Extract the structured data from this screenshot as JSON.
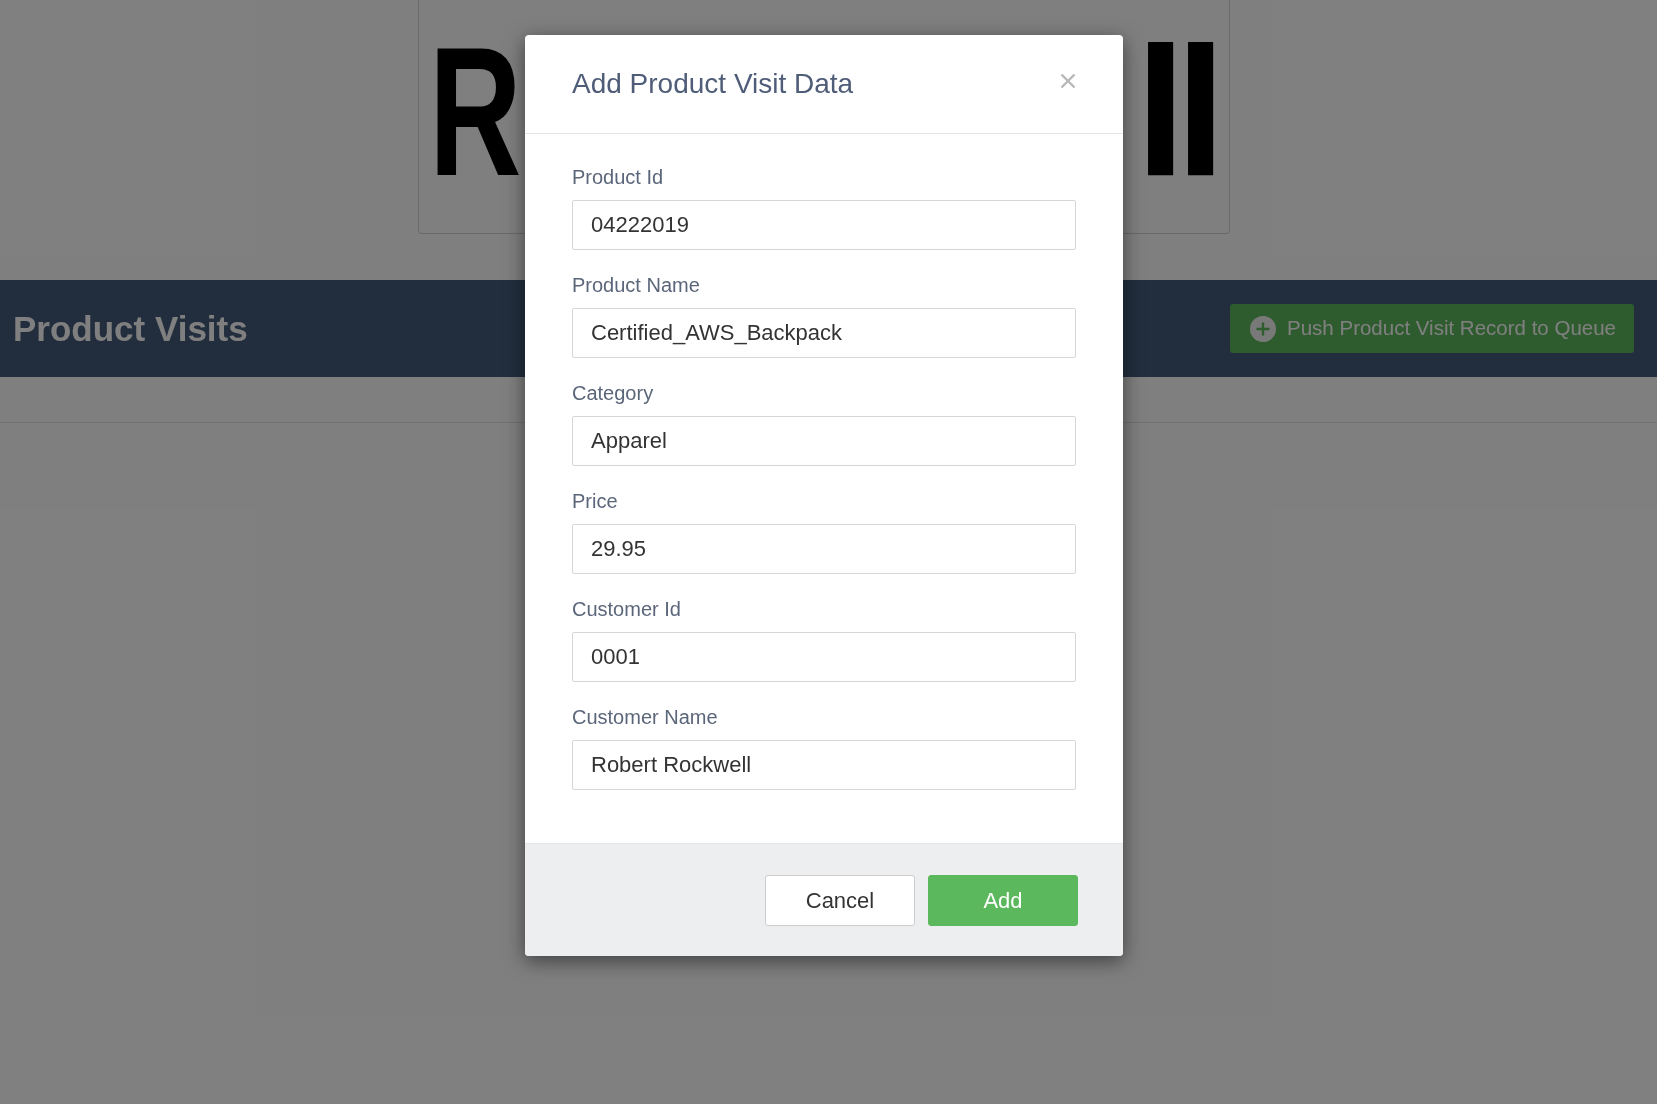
{
  "background": {
    "logo": {
      "left_part": "R",
      "right_part": "ll"
    },
    "header": {
      "title": "Product Visits",
      "push_button": {
        "label": "Push Product Visit Record to Queue"
      }
    }
  },
  "modal": {
    "title": "Add Product Visit Data",
    "fields": [
      {
        "label": "Product Id",
        "value": "04222019"
      },
      {
        "label": "Product Name",
        "value": "Certified_AWS_Backpack"
      },
      {
        "label": "Category",
        "value": "Apparel"
      },
      {
        "label": "Price",
        "value": "29.95"
      },
      {
        "label": "Customer Id",
        "value": "0001"
      },
      {
        "label": "Customer Name",
        "value": "Robert Rockwell"
      }
    ],
    "buttons": [
      {
        "label": "Cancel",
        "kind": "secondary"
      },
      {
        "label": "Add",
        "kind": "primary"
      }
    ]
  }
}
